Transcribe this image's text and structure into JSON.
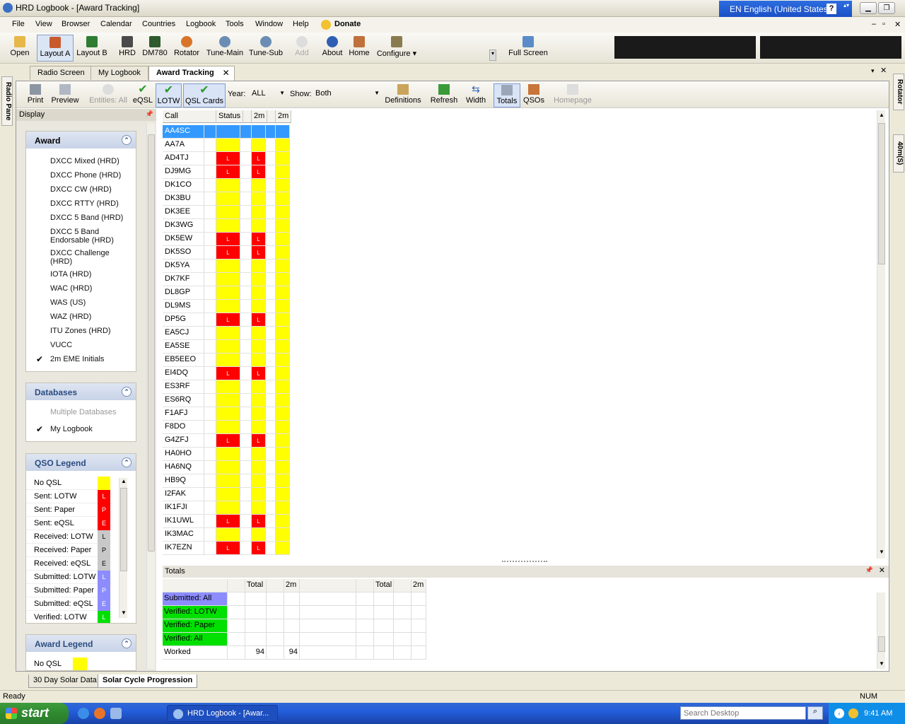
{
  "window": {
    "title": "HRD Logbook - [Award Tracking]",
    "language": "EN English (United States)",
    "help_glyph": "?"
  },
  "menu": [
    "File",
    "View",
    "Browser",
    "Calendar",
    "Countries",
    "Logbook",
    "Tools",
    "Window",
    "Help",
    "Donate"
  ],
  "toolbar": [
    {
      "label": "Open",
      "icon": "folder-icon",
      "color": "#e6b84a"
    },
    {
      "label": "Layout A",
      "icon": "layout-a-icon",
      "color": "#c85a2e",
      "selected": true
    },
    {
      "label": "Layout B",
      "icon": "layout-b-icon",
      "color": "#2e7d32"
    },
    {
      "label": "HRD",
      "icon": "radio-icon",
      "color": "#4a4a4a"
    },
    {
      "label": "DM780",
      "icon": "dm780-icon",
      "color": "#2e5a2e"
    },
    {
      "label": "Rotator",
      "icon": "rotator-icon",
      "color": "#d8742a"
    },
    {
      "label": "Tune-Main",
      "icon": "satellite-icon",
      "color": "#6b8db5"
    },
    {
      "label": "Tune-Sub",
      "icon": "satellite-sub-icon",
      "color": "#6b8db5"
    },
    {
      "label": "Add",
      "icon": "add-icon",
      "color": "#cccccc",
      "disabled": true
    },
    {
      "label": "About",
      "icon": "about-icon",
      "color": "#2f5fb3"
    },
    {
      "label": "Home",
      "icon": "home-icon",
      "color": "#c0713b"
    },
    {
      "label": "Configure",
      "icon": "configure-icon",
      "color": "#8a7b4f"
    },
    {
      "label": "Full Screen",
      "icon": "fullscreen-icon",
      "color": "#5a8cc8"
    }
  ],
  "tabs": [
    {
      "label": "Radio Screen"
    },
    {
      "label": "My Logbook"
    },
    {
      "label": "Award Tracking",
      "active": true
    }
  ],
  "side_tabs": {
    "left": "Radio Pane",
    "right_top": "Rotator",
    "right_bottom": "40m(S)"
  },
  "subtoolbar": {
    "items": [
      {
        "label": "Print",
        "icon": "print-icon"
      },
      {
        "label": "Preview",
        "icon": "preview-icon"
      },
      {
        "label": "Entities: All",
        "icon": "entities-icon",
        "disabled": true
      },
      {
        "label": "eQSL",
        "icon": "check-icon"
      },
      {
        "label": "LOTW",
        "icon": "check-icon",
        "selected": true
      },
      {
        "label": "QSL Cards",
        "icon": "check-icon",
        "selected": true
      },
      {
        "label": "Definitions",
        "icon": "definitions-icon"
      },
      {
        "label": "Refresh",
        "icon": "refresh-icon"
      },
      {
        "label": "Width",
        "icon": "width-icon"
      },
      {
        "label": "Totals",
        "icon": "totals-icon",
        "selected": true
      },
      {
        "label": "QSOs",
        "icon": "qsos-icon"
      },
      {
        "label": "Homepage",
        "icon": "homepage-icon",
        "disabled": true
      }
    ],
    "year_label": "Year:",
    "year_value": "ALL",
    "show_label": "Show:",
    "show_value": "Both"
  },
  "display_panel": {
    "title": "Display",
    "award": {
      "title": "Award",
      "items": [
        "DXCC Mixed (HRD)",
        "DXCC Phone (HRD)",
        "DXCC CW (HRD)",
        "DXCC RTTY (HRD)",
        "DXCC 5 Band (HRD)",
        "DXCC 5 Band Endorsable (HRD)",
        "DXCC Challenge (HRD)",
        "IOTA (HRD)",
        "WAC (HRD)",
        "WAS (US)",
        "WAZ (HRD)",
        "ITU Zones (HRD)",
        "VUCC",
        "2m EME Initials"
      ],
      "checked": "2m EME Initials"
    },
    "databases": {
      "title": "Databases",
      "items": [
        "Multiple Databases",
        "My Logbook"
      ],
      "checked": "My Logbook"
    },
    "qso_legend": {
      "title": "QSO Legend",
      "items": [
        {
          "label": "No QSL",
          "code": "",
          "color": "#ffff00"
        },
        {
          "label": "Sent: LOTW",
          "code": "L",
          "color": "#ff0000"
        },
        {
          "label": "Sent: Paper",
          "code": "P",
          "color": "#ff0000"
        },
        {
          "label": "Sent: eQSL",
          "code": "E",
          "color": "#ff0000"
        },
        {
          "label": "Received: LOTW",
          "code": "L",
          "color": "#c8c8c8"
        },
        {
          "label": "Received: Paper",
          "code": "P",
          "color": "#c8c8c8"
        },
        {
          "label": "Received: eQSL",
          "code": "E",
          "color": "#c8c8c8"
        },
        {
          "label": "Submitted: LOTW",
          "code": "L",
          "color": "#8c8cff"
        },
        {
          "label": "Submitted: Paper",
          "code": "P",
          "color": "#8c8cff"
        },
        {
          "label": "Submitted: eQSL",
          "code": "E",
          "color": "#8c8cff"
        },
        {
          "label": "Verified: LOTW",
          "code": "L",
          "color": "#00e000"
        }
      ]
    },
    "award_legend": {
      "title": "Award Legend",
      "items": [
        {
          "label": "No QSL",
          "color": "#ffff00"
        }
      ]
    }
  },
  "grid": {
    "headers": [
      "Call",
      "Status",
      "2m",
      "2m"
    ],
    "rows": [
      {
        "call": "AA4SC",
        "s": "",
        "selected": true
      },
      {
        "call": "AA7A",
        "s": ""
      },
      {
        "call": "AD4TJ",
        "s": "L"
      },
      {
        "call": "DJ9MG",
        "s": "L"
      },
      {
        "call": "DK1CO",
        "s": ""
      },
      {
        "call": "DK3BU",
        "s": ""
      },
      {
        "call": "DK3EE",
        "s": ""
      },
      {
        "call": "DK3WG",
        "s": ""
      },
      {
        "call": "DK5EW",
        "s": "L"
      },
      {
        "call": "DK5SO",
        "s": "L"
      },
      {
        "call": "DK5YA",
        "s": ""
      },
      {
        "call": "DK7KF",
        "s": ""
      },
      {
        "call": "DL8GP",
        "s": ""
      },
      {
        "call": "DL9MS",
        "s": ""
      },
      {
        "call": "DP5G",
        "s": "L"
      },
      {
        "call": "EA5CJ",
        "s": ""
      },
      {
        "call": "EA5SE",
        "s": ""
      },
      {
        "call": "EB5EEO",
        "s": ""
      },
      {
        "call": "EI4DQ",
        "s": "L"
      },
      {
        "call": "ES3RF",
        "s": ""
      },
      {
        "call": "ES6RQ",
        "s": ""
      },
      {
        "call": "F1AFJ",
        "s": ""
      },
      {
        "call": "F8DO",
        "s": ""
      },
      {
        "call": "G4ZFJ",
        "s": "L"
      },
      {
        "call": "HA0HO",
        "s": ""
      },
      {
        "call": "HA6NQ",
        "s": ""
      },
      {
        "call": "HB9Q",
        "s": ""
      },
      {
        "call": "I2FAK",
        "s": ""
      },
      {
        "call": "IK1FJI",
        "s": ""
      },
      {
        "call": "IK1UWL",
        "s": "L"
      },
      {
        "call": "IK3MAC",
        "s": ""
      },
      {
        "call": "IK7EZN",
        "s": "L"
      }
    ],
    "colors": {
      "no_qsl": "#ffff00",
      "sent": "#ff0000",
      "selected": "#3399ff"
    }
  },
  "totals": {
    "title": "Totals",
    "headers": [
      "Total",
      "2m",
      "Total",
      "2m"
    ],
    "rows": [
      {
        "label": "Submitted: All",
        "color": "#8c8cff",
        "total": "",
        "m2": ""
      },
      {
        "label": "Verified: LOTW",
        "color": "#00e000",
        "total": "",
        "m2": ""
      },
      {
        "label": "Verified: Paper",
        "color": "#00e000",
        "total": "",
        "m2": ""
      },
      {
        "label": "Verified: All",
        "color": "#00e000",
        "total": "",
        "m2": ""
      },
      {
        "label": "Worked",
        "color": "#ffffff",
        "total": "94",
        "m2": "94"
      }
    ]
  },
  "bottom_tabs": [
    {
      "label": "30 Day Solar Data"
    },
    {
      "label": "Solar Cycle Progression",
      "active": true
    }
  ],
  "status": {
    "text": "Ready",
    "num": "NUM"
  },
  "taskbar": {
    "start": "start",
    "item": "HRD Logbook - [Awar...",
    "search_placeholder": "Search Desktop",
    "time": "9:41 AM"
  }
}
